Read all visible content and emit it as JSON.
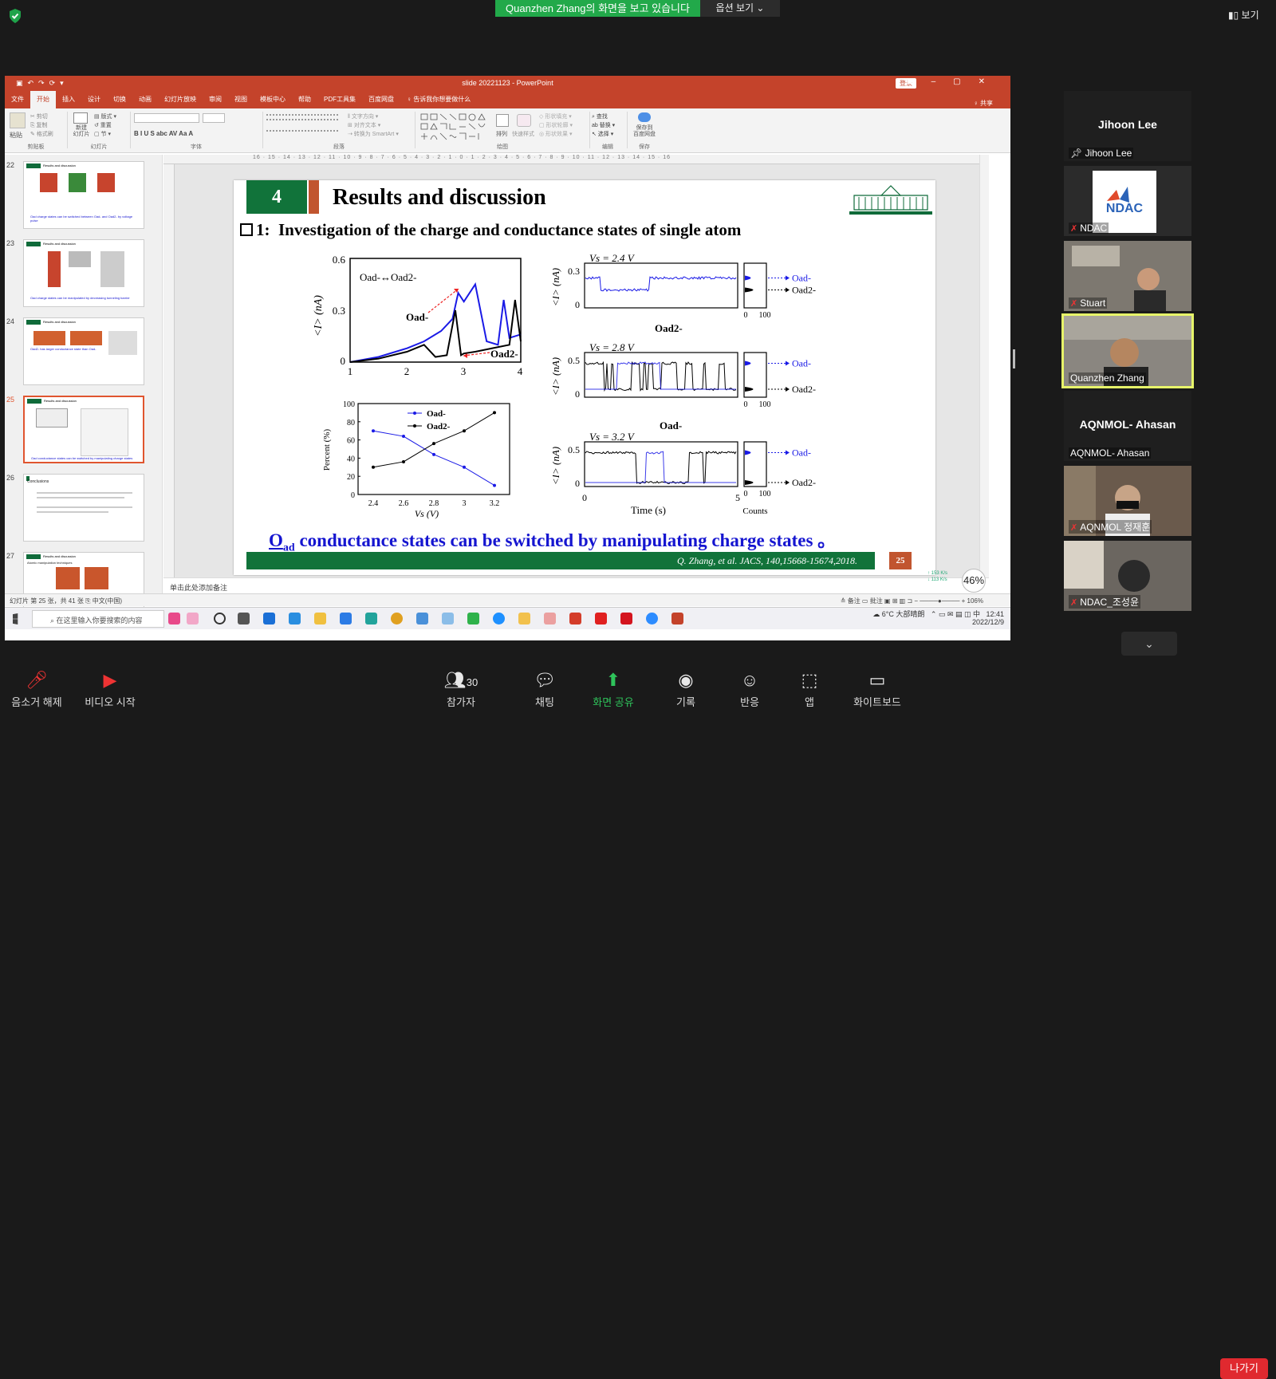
{
  "zoom": {
    "share_banner": "Quanzhen Zhang의 화면을 보고 있습니다",
    "view_options": "옵션 보기 ⌄",
    "view_button": "▮▯ 보기",
    "bottom": {
      "mute": "음소거 해제",
      "video": "비디오 시작",
      "participants": "참가자",
      "participants_count": "30",
      "chat": "채팅",
      "share": "화면 공유",
      "record": "기록",
      "reactions": "반응",
      "apps": "앱",
      "whiteboard": "화이트보드",
      "leave": "나가기"
    },
    "gallery": [
      {
        "big": "Jihoon Lee",
        "name": "Jihoon Lee",
        "pinned": true
      },
      {
        "name": "NDAC",
        "muted": true,
        "logo": "NDAC"
      },
      {
        "name": "Stuart",
        "muted": true
      },
      {
        "name": "Quanzhen Zhang",
        "active": true
      },
      {
        "big": "AQNMOL- Ahasan",
        "name": "AQNMOL- Ahasan"
      },
      {
        "name": "AQNMOL 정재훈",
        "muted": true
      },
      {
        "name": "NDAC_조성윤",
        "muted": true
      }
    ],
    "active_color": "#e7f56a"
  },
  "ppt": {
    "title": "slide 20221123 - PowerPoint",
    "login": "登录",
    "tabs": [
      "文件",
      "开始",
      "插入",
      "设计",
      "切换",
      "动画",
      "幻灯片放映",
      "审阅",
      "视图",
      "模板中心",
      "帮助",
      "PDF工具集",
      "百度网盘"
    ],
    "active_tab": "开始",
    "tell_me": "♀ 告诉我你想要做什么",
    "share": "♀ 共享",
    "ribbon": {
      "paste": "粘贴",
      "clipboard_items": [
        "✂ 剪切",
        "⎘ 复制",
        "✎ 格式刷"
      ],
      "new_slide": "新建\n幻灯片",
      "slide_items": [
        "▤ 版式 ▾",
        "↺ 重置",
        "▢ 节 ▾"
      ],
      "font_buttons": "B  I  U  S  abc  AV  Aa  A",
      "paragraph_items": [
        "‖ 文字方向 ▾",
        "⊞ 对齐文本 ▾",
        "⇢ 转换为 SmartArt ▾"
      ],
      "arrange": "排列",
      "quick_styles": "快速样式",
      "shape_items": [
        "◇ 形状填充 ▾",
        "▢ 形状轮廓 ▾",
        "◎ 形状效果 ▾"
      ],
      "edit_items": [
        "⌕ 查找",
        "ab 替换 ▾",
        "↖ 选择 ▾"
      ],
      "save_cloud": "保存到\n百度网盘",
      "groups": [
        "剪贴板",
        "幻灯片",
        "字体",
        "段落",
        "绘图",
        "编辑",
        "保存"
      ]
    },
    "thumbnails": [
      {
        "num": "22",
        "caption": "Oad charge states can be switched between Oad- and Oad2- by voltage pulse"
      },
      {
        "num": "23",
        "caption": "Oad charge states can be manipulated by decreasing tunneling barrier"
      },
      {
        "num": "24",
        "caption": "Oad2- has larger conductance state than Oad-"
      },
      {
        "num": "25",
        "caption": "Oad conductance states can be switched by manipulating charge states",
        "selected": true
      },
      {
        "num": "26",
        "caption": "Conclusions"
      },
      {
        "num": "27",
        "caption": "Atomic manipulation techniques"
      }
    ],
    "notes_placeholder": "单击此处添加备注",
    "status_left": "幻灯片 第 25 张，共 41 张    ⎘    中文(中国)",
    "status_right": "≙ 备注   ▭ 批注   ▣  ⊞  ▥  ⊐   −  ────●────  +  106%",
    "ruler": "16 · 15 · 14 · 13 · 12 · 11 · 10 · 9 · 8 · 7 · 6 · 5 · 4 · 3 · 2 · 1 · 0 · 1 · 2 · 3 · 4 · 5 · 6 · 7 · 8 · 9 · 10 · 11 · 12 · 13 · 14 · 15 · 16",
    "zoom_badge": "46%",
    "net_speed": "↑ 153 K/s\n↓ 113 K/s"
  },
  "slide": {
    "section_num": "4",
    "title": "Results and discussion",
    "subtitle_prefix": "1:",
    "subtitle": "Investigation of the charge and conductance states of single atom",
    "conclusion_main": "O",
    "conclusion_sub": "ad",
    "conclusion_rest": " conductance states can be switched by manipulating charge states 。",
    "reference": "Q. Zhang, et al. JACS, 140,15668-15674,2018.",
    "page": "25",
    "logo_text": "北京理工大学"
  },
  "chart_data": [
    {
      "type": "line",
      "name": "I-V curve",
      "xlim": [
        1,
        4
      ],
      "ylim": [
        0,
        0.6
      ],
      "xticks": [
        "1",
        "2",
        "3",
        "4"
      ],
      "yticks": [
        "0",
        "0.3",
        "0.6"
      ],
      "ylabel": "<I> (nA)",
      "annotations": [
        "Oad-↔Oad2-",
        "Oad-",
        "Oad2-"
      ],
      "series": [
        {
          "color": "#1a1ae6",
          "x": [
            1,
            1.5,
            2,
            2.3,
            2.6,
            2.8,
            2.9,
            3.0,
            3.2,
            3.4,
            3.6,
            3.7,
            3.8,
            4.0
          ],
          "y": [
            0.0,
            0.03,
            0.08,
            0.12,
            0.18,
            0.25,
            0.4,
            0.35,
            0.45,
            0.12,
            0.1,
            0.36,
            0.14,
            0.16
          ]
        },
        {
          "color": "#000000",
          "x": [
            1,
            1.5,
            2,
            2.3,
            2.5,
            2.7,
            2.85,
            2.95,
            3.0,
            3.2,
            3.5,
            3.8,
            3.9,
            4.0
          ],
          "y": [
            0.0,
            0.02,
            0.06,
            0.1,
            0.03,
            0.04,
            0.3,
            0.04,
            0.05,
            0.06,
            0.08,
            0.1,
            0.36,
            0.12
          ]
        }
      ]
    },
    {
      "type": "line",
      "name": "Percent vs Vs",
      "x": [
        2.4,
        2.6,
        2.8,
        3.0,
        3.2
      ],
      "xticks": [
        "2.4",
        "2.6",
        "2.8",
        "3",
        "3.2"
      ],
      "yticks": [
        "0",
        "20",
        "40",
        "60",
        "80",
        "100"
      ],
      "xlim": [
        2.3,
        3.3
      ],
      "ylim": [
        0,
        100
      ],
      "xlabel": "Vs (V)",
      "ylabel": "Percent (%)",
      "series": [
        {
          "name": "Oad-",
          "color": "#1a1ae6",
          "values": [
            70,
            64,
            44,
            30,
            10
          ]
        },
        {
          "name": "Oad2-",
          "color": "#000000",
          "values": [
            30,
            36,
            56,
            70,
            90
          ]
        }
      ]
    },
    {
      "type": "line",
      "name": "Telegraph current traces",
      "xlabel": "Time (s)",
      "x_ticks": [
        "0",
        "5"
      ],
      "count_label": "Counts",
      "count_ticks": [
        "0",
        "100"
      ],
      "ylabel": "<I> (nA)",
      "panels": [
        {
          "label": "Vs = 2.4 V",
          "yticks": [
            "0",
            "0.3"
          ],
          "state_label": "Oad2-"
        },
        {
          "label": "Vs = 2.8 V",
          "yticks": [
            "0",
            "0.5"
          ]
        },
        {
          "label": "Vs = 3.2 V",
          "yticks": [
            "0",
            "0.5"
          ],
          "state_label": "Oad-"
        }
      ],
      "legend": [
        "Oad-",
        "Oad2-"
      ]
    }
  ]
}
